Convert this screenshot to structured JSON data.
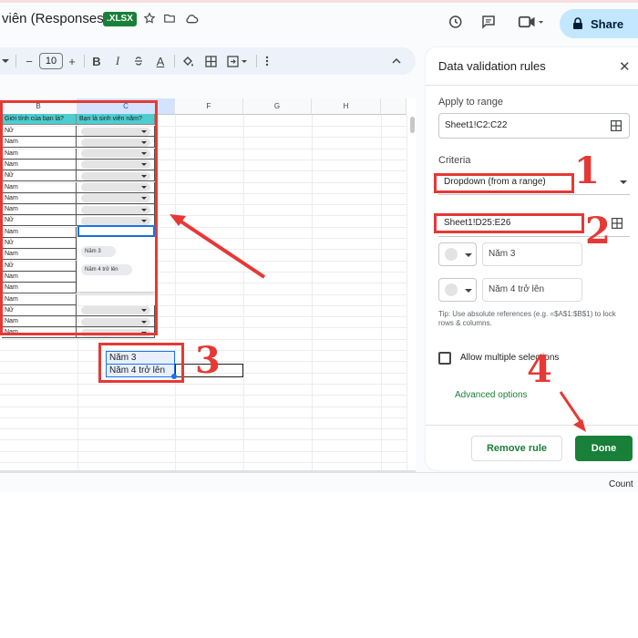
{
  "app": {
    "doc_title": "viên (Responses)",
    "file_badge": ".XLSX",
    "share_label": "Share"
  },
  "toolbar": {
    "font_size": "10",
    "bold": "B",
    "italic": "I",
    "text_color": "A",
    "minus": "−",
    "plus": "+"
  },
  "sheet": {
    "columns": [
      "B",
      "C",
      "",
      "F",
      "G",
      "H"
    ],
    "header_b": "Giới tính của bạn là?",
    "header_c": "Bạn là sinh viên năm?",
    "b_values": [
      "Nữ",
      "Nam",
      "Nam",
      "Nam",
      "Nữ",
      "Nam",
      "Nam",
      "Nam",
      "Nữ",
      "Nam",
      "Nữ",
      "Nam",
      "Nữ",
      "Nam",
      "Nam",
      "Nam",
      "Nữ",
      "Nam",
      "Nam"
    ],
    "dropdown_options": [
      "Năm 3",
      "Năm 4 trở lên"
    ],
    "source_cells": [
      "Năm 3",
      "Năm 4 trở lên"
    ]
  },
  "panel": {
    "title": "Data validation rules",
    "apply_label": "Apply to range",
    "apply_value": "Sheet1!C2:C22",
    "criteria_label": "Criteria",
    "criteria_value": "Dropdown (from a range)",
    "range_value": "Sheet1!D25:E26",
    "options": [
      "Năm 3",
      "Năm 4 trở lên"
    ],
    "tip": "Tip: Use absolute references (e.g. =$A$1:$B$1) to lock rows & columns.",
    "multi_label": "Allow multiple selections",
    "advanced_label": "Advanced options",
    "remove_label": "Remove rule",
    "done_label": "Done"
  },
  "status": {
    "count_label": "Count"
  },
  "annotations": {
    "steps": [
      "1",
      "2",
      "3",
      "4"
    ],
    "color": "#e53935"
  }
}
